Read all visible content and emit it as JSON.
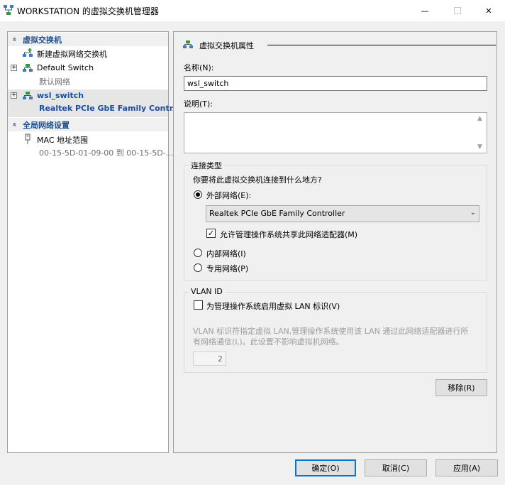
{
  "window": {
    "title": "WORKSTATION 的虚拟交换机管理器",
    "minimize_glyph": "—",
    "close_glyph": "✕"
  },
  "tree": {
    "section_switches": "虚拟交换机",
    "new_switch": "新建虚拟网络交换机",
    "items": [
      {
        "name": "Default Switch",
        "sub": "默认网络"
      },
      {
        "name": "wsl_switch",
        "sub": "Realtek PCIe GbE Family Contr..."
      }
    ],
    "section_global": "全局网络设置",
    "mac_range": {
      "name": "MAC 地址范围",
      "sub": "00-15-5D-01-09-00 到 00-15-5D-..."
    },
    "expand_glyph": "+",
    "collapse_glyph": "«"
  },
  "props": {
    "header": "虚拟交换机属性",
    "name_label": "名称(N):",
    "name_value": "wsl_switch",
    "notes_label": "说明(T):",
    "notes_value": "",
    "connection_group": "连接类型",
    "connection_question": "你要将此虚拟交换机连接到什么地方?",
    "external_label": "外部网络(E):",
    "adapter_value": "Realtek PCIe GbE Family Controller",
    "allow_share_label": "允许管理操作系统共享此网络适配器(M)",
    "internal_label": "内部网络(I)",
    "private_label": "专用网络(P)",
    "vlan_group": "VLAN ID",
    "vlan_enable_label": "为管理操作系统启用虚拟 LAN 标识(V)",
    "vlan_desc_1": "VLAN 标识符指定虚拟 LAN,管理操作系统使用该 LAN 通过此网络适配器进行所",
    "vlan_desc_2": "有网络通信(L)。此设置不影响虚拟机网络。",
    "vlan_value": "2",
    "remove_button": "移除(R)",
    "check_glyph": "✓",
    "dropdown_glyph": "⌄"
  },
  "footer": {
    "ok": "确定(O)",
    "cancel": "取消(C)",
    "apply": "应用(A)"
  },
  "selection": {
    "external": true,
    "internal": false,
    "private": false,
    "allow_share": true,
    "vlan_enable": false
  },
  "colors": {
    "accent": "#0078d7",
    "selected_text": "#1a4ea0",
    "section_text": "#1e4e8c"
  }
}
